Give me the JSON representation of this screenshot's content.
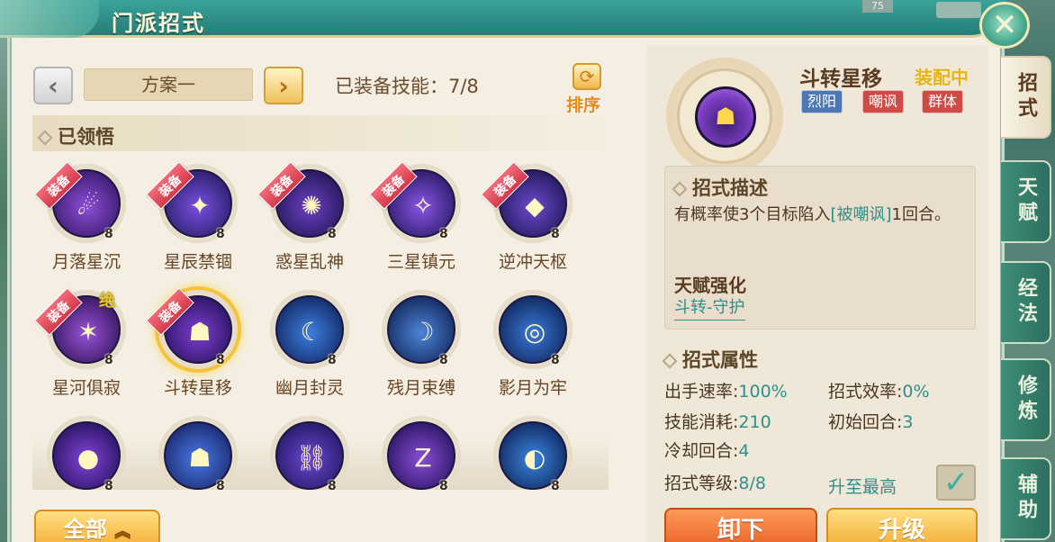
{
  "window": {
    "title": "门派招式",
    "close_icon": "✕",
    "counter": "75"
  },
  "toolbar": {
    "prev_icon": "‹",
    "next_icon": "›",
    "scheme_label": "方案一",
    "equipped_count": "已装备技能：7/8",
    "sort_icon": "⟳",
    "sort_label": "排序"
  },
  "section": {
    "title": "已领悟"
  },
  "badges": {
    "equip": "装备",
    "jue": "绝"
  },
  "skills": [
    {
      "name": "月落星沉",
      "level": "8",
      "equipped": true,
      "glyph": "☄"
    },
    {
      "name": "星辰禁锢",
      "level": "8",
      "equipped": true,
      "glyph": "✦"
    },
    {
      "name": "惑星乱神",
      "level": "8",
      "equipped": true,
      "glyph": "✺"
    },
    {
      "name": "三星镇元",
      "level": "8",
      "equipped": true,
      "glyph": "✧"
    },
    {
      "name": "逆冲天枢",
      "level": "8",
      "equipped": true,
      "glyph": "◆"
    },
    {
      "name": "星河俱寂",
      "level": "8",
      "equipped": true,
      "jue": true,
      "glyph": "✶"
    },
    {
      "name": "斗转星移",
      "level": "8",
      "equipped": true,
      "selected": true,
      "glyph": "☗"
    },
    {
      "name": "幽月封灵",
      "level": "8",
      "equipped": false,
      "glyph": "☾"
    },
    {
      "name": "残月束缚",
      "level": "8",
      "equipped": false,
      "glyph": "☽"
    },
    {
      "name": "影月为牢",
      "level": "8",
      "equipped": false,
      "glyph": "◎"
    },
    {
      "name": "",
      "level": "8",
      "equipped": false,
      "glyph": "●"
    },
    {
      "name": "",
      "level": "8",
      "equipped": false,
      "glyph": "☗"
    },
    {
      "name": "",
      "level": "8",
      "equipped": false,
      "glyph": "⛓"
    },
    {
      "name": "",
      "level": "8",
      "equipped": false,
      "glyph": "Z"
    },
    {
      "name": "",
      "level": "8",
      "equipped": false,
      "glyph": "◐"
    }
  ],
  "filter": {
    "label": "全部",
    "icon": "︽"
  },
  "detail": {
    "icon_glyph": "☗",
    "name": "斗转星移",
    "status": "装配中",
    "tags": [
      "烈阳",
      "嘲讽",
      "群体"
    ],
    "desc_title": "招式描述",
    "desc_prefix": "有概率使3个目标陷入",
    "desc_highlight": "[被嘲讽]",
    "desc_suffix": "1回合。",
    "talent_title": "天赋强化",
    "talent_link": "斗转-守护",
    "attr_title": "招式属性",
    "attrs": {
      "speed_label": "出手速率:",
      "speed": "100%",
      "efficiency_label": "招式效率:",
      "efficiency": "0%",
      "cost_label": "技能消耗:",
      "cost": "210",
      "init_round_label": "初始回合:",
      "init_round": "3",
      "cooldown_label": "冷却回合:",
      "cooldown": "4",
      "level_label": "招式等级:",
      "level": "8/8"
    },
    "max_label": "升至最高",
    "check_icon": "✓",
    "unload_label": "卸下",
    "upgrade_label": "升级"
  },
  "side_tabs": [
    "招式",
    "天赋",
    "经法",
    "修炼",
    "辅助"
  ],
  "colors": {
    "title_bar": "#2f9189",
    "accent_teal": "#2f8f8a",
    "equip_badge": "#e04a5a",
    "gold": "#f2a92f"
  }
}
